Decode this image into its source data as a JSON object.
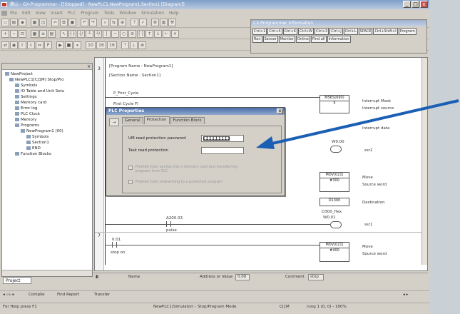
{
  "window": {
    "title": "鹿山 - GX-Programmer - [[Stopped] - NewPLC1.NewProgram1.Section1 [Diagram]]",
    "controls": [
      "_",
      "□",
      "x"
    ]
  },
  "menu": {
    "items": [
      "File",
      "Edit",
      "View",
      "Insert",
      "PLC",
      "Program",
      "Tools",
      "Window",
      "Simulation",
      "Help"
    ]
  },
  "info_panel": {
    "title": "CX-Programmer Information",
    "keys": [
      "Ctrl+1",
      "Ctrl+4",
      "Ctrl+K",
      "Ctrl+W",
      "Ctrl+3",
      "Ctrl+j",
      "Ctrl+L",
      "SPACE",
      "Ctrl+Shift+I",
      "Program",
      "Run",
      "Sensor",
      "Monitor",
      "Online",
      "Find all",
      "Information"
    ]
  },
  "project_tree": {
    "items": [
      {
        "label": "NewProject",
        "indent": 0
      },
      {
        "label": "NewPLC1[CJ1M] Stop/Pro",
        "indent": 1
      },
      {
        "label": "Symbols",
        "indent": 2
      },
      {
        "label": "IO Table and Unit Setu",
        "indent": 2
      },
      {
        "label": "Settings",
        "indent": 2
      },
      {
        "label": "Memory card",
        "indent": 2
      },
      {
        "label": "Error log",
        "indent": 2
      },
      {
        "label": "PLC Clock",
        "indent": 2
      },
      {
        "label": "Memory",
        "indent": 2
      },
      {
        "label": "Programs",
        "indent": 2
      },
      {
        "label": "NewProgram1 (00)",
        "indent": 3
      },
      {
        "label": "Symbols",
        "indent": 4
      },
      {
        "label": "Section1",
        "indent": 4
      },
      {
        "label": "END",
        "indent": 4
      },
      {
        "label": "Function Blocks",
        "indent": 2
      }
    ],
    "tab_label": "Project"
  },
  "diagram": {
    "program_name": "[Program Name : NewProgram1]",
    "section_name": "[Section Name : Section1]",
    "step1": "3",
    "step2": "7",
    "contact_first_cycle": "P_First_Cycle",
    "contact_first_cycle2": "First Cycle Fl",
    "instr_msks": "MSKS(690)",
    "instr_msks_val": "5",
    "interrupt_mask": "Interrupt Mask",
    "interrupt_source": "Interrupt source",
    "interrupt_data": "Interrupt data",
    "w0_00": "W0.00",
    "ssr2": "ssr2",
    "mov1": "MOV(021)",
    "mov1_src": "#300",
    "mov1_dst": "D1300",
    "d300_hex": "D300_Hex",
    "w0_01": "W0.01",
    "move1": "Move",
    "source_word": "Source word",
    "destination": "Destination",
    "a200_03": "A200.03",
    "pulse": "pulse",
    "ssr1": "ssr1",
    "contact_0_01": "0.01",
    "stop_on": "stop on",
    "mov2": "MOV(021)",
    "mov2_src": "#400",
    "move2": "Move",
    "source_word2": "Source word"
  },
  "dialog": {
    "title": "PLC Properties",
    "close": "x",
    "tabs": [
      "General",
      "Protection",
      "Function Block"
    ],
    "um_label": "UM read protection password",
    "um_value": "●●●●●●●●",
    "task_label": "Task read protection",
    "chk1": "Prohibit from saving into a memory card and transferring program from PLC",
    "chk2": "Prohibit from overwriting to a protected program"
  },
  "status_row": {
    "name_label": "Name",
    "address_label": "Address or Value",
    "address_value": "0.00",
    "comment_label": "Comment",
    "comment_value": "stop"
  },
  "sheet_tabs": {
    "items": [
      "Compile",
      "Find Report",
      "Transfer"
    ]
  },
  "statusbar": {
    "help": "For Help press F1",
    "plc": "NewPLC1(Simulator) - Stop/Program Mode",
    "mode": "CJ1M",
    "rung": "rung 1 (0, 0) - 100%"
  },
  "colors": {
    "arrow": "#1a5fb4",
    "titlebar": "#7f9fc9",
    "dialog_title": "#4a6ea9"
  }
}
